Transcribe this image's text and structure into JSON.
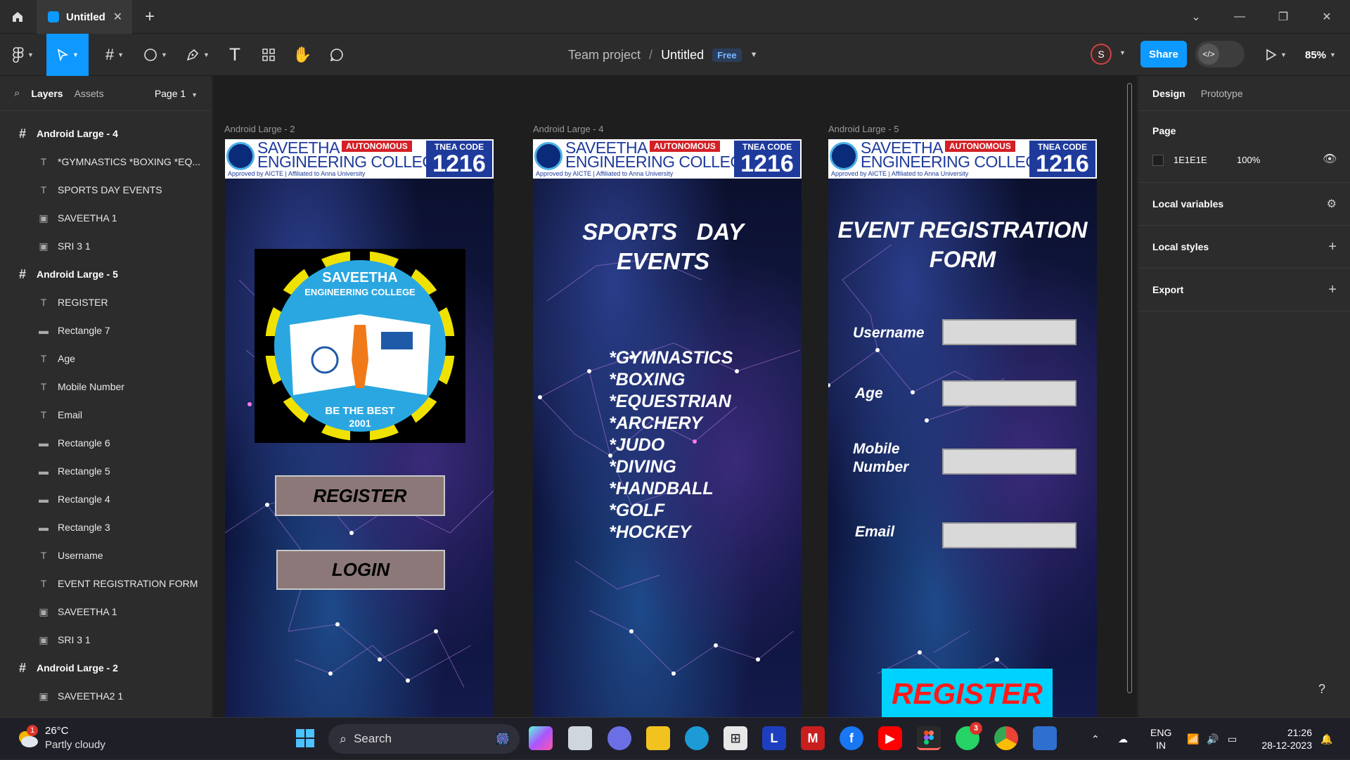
{
  "tabbar": {
    "tab_title": "Untitled"
  },
  "toolbar": {
    "team": "Team project",
    "separator": "/",
    "file": "Untitled",
    "plan_badge": "Free",
    "avatar_initial": "S",
    "share_label": "Share",
    "zoom": "85%"
  },
  "left_panel": {
    "tabs": [
      "Layers",
      "Assets"
    ],
    "page_selector": "Page 1",
    "layers": [
      {
        "type": "frame",
        "name": "Android Large - 4"
      },
      {
        "type": "text",
        "name": "*GYMNASTICS *BOXING *EQ..."
      },
      {
        "type": "text",
        "name": "SPORTS DAY EVENTS"
      },
      {
        "type": "image",
        "name": "SAVEETHA 1"
      },
      {
        "type": "image",
        "name": "SRI 3 1"
      },
      {
        "type": "frame",
        "name": "Android Large - 5"
      },
      {
        "type": "text",
        "name": "REGISTER"
      },
      {
        "type": "rect",
        "name": "Rectangle 7"
      },
      {
        "type": "text",
        "name": "Age"
      },
      {
        "type": "text",
        "name": "Mobile Number"
      },
      {
        "type": "text",
        "name": "Email"
      },
      {
        "type": "rect",
        "name": "Rectangle 6"
      },
      {
        "type": "rect",
        "name": "Rectangle 5"
      },
      {
        "type": "rect",
        "name": "Rectangle 4"
      },
      {
        "type": "rect",
        "name": "Rectangle 3"
      },
      {
        "type": "text",
        "name": "Username"
      },
      {
        "type": "text",
        "name": "EVENT REGISTRATION FORM"
      },
      {
        "type": "image",
        "name": "SAVEETHA 1"
      },
      {
        "type": "image",
        "name": "SRI 3 1"
      },
      {
        "type": "frame",
        "name": "Android Large - 2"
      },
      {
        "type": "image",
        "name": "SAVEETHA2 1"
      },
      {
        "type": "image",
        "name": "SAVEETHA 1"
      }
    ]
  },
  "canvas": {
    "banner": {
      "college_line1": "SAVEETHA",
      "college_line2": "ENGINEERING COLLEGE",
      "autonomous": "AUTONOMOUS",
      "approval": "Approved by AICTE | Affiliated to Anna University",
      "tnea_label": "TNEA CODE",
      "tnea_code": "1216"
    },
    "frame2": {
      "label": "Android Large - 2",
      "logo_name": "SAVEETHA",
      "logo_sub": "ENGINEERING COLLEGE",
      "logo_motto": "BE THE BEST",
      "logo_year": "2001",
      "register": "REGISTER",
      "login": "LOGIN"
    },
    "frame4": {
      "label": "Android Large - 4",
      "title_line1": "SPORTS   DAY",
      "title_line2": "EVENTS",
      "events": [
        "*GYMNASTICS",
        "*BOXING",
        "*EQUESTRIAN",
        "*ARCHERY",
        "*JUDO",
        "*DIVING",
        "*HANDBALL",
        "*GOLF",
        "*HOCKEY"
      ]
    },
    "frame5": {
      "label": "Android Large - 5",
      "title_line1": "EVENT REGISTRATION",
      "title_line2": "FORM",
      "username": "Username",
      "age": "Age",
      "mobile_line1": "Mobile",
      "mobile_line2": "Number",
      "email": "Email",
      "register": "REGISTER"
    }
  },
  "right_panel": {
    "tabs": [
      "Design",
      "Prototype"
    ],
    "page_section": "Page",
    "page_color": "1E1E1E",
    "page_opacity": "100%",
    "local_variables": "Local variables",
    "local_styles": "Local styles",
    "export": "Export",
    "help": "?"
  },
  "taskbar": {
    "weather_temp": "26°C",
    "weather_desc": "Partly cloudy",
    "weather_badge": "1",
    "search": "Search",
    "whatsapp_badge": "3",
    "lang_line1": "ENG",
    "lang_line2": "IN",
    "time": "21:26",
    "date": "28-12-2023"
  },
  "colors": {
    "accent": "#0d99ff",
    "canvas_bg": "#1e1e1e",
    "panel_bg": "#2c2c2c",
    "register_cyan": "#00d2ff",
    "register_red": "#ff1a1a",
    "grey_button": "#8c7878"
  }
}
